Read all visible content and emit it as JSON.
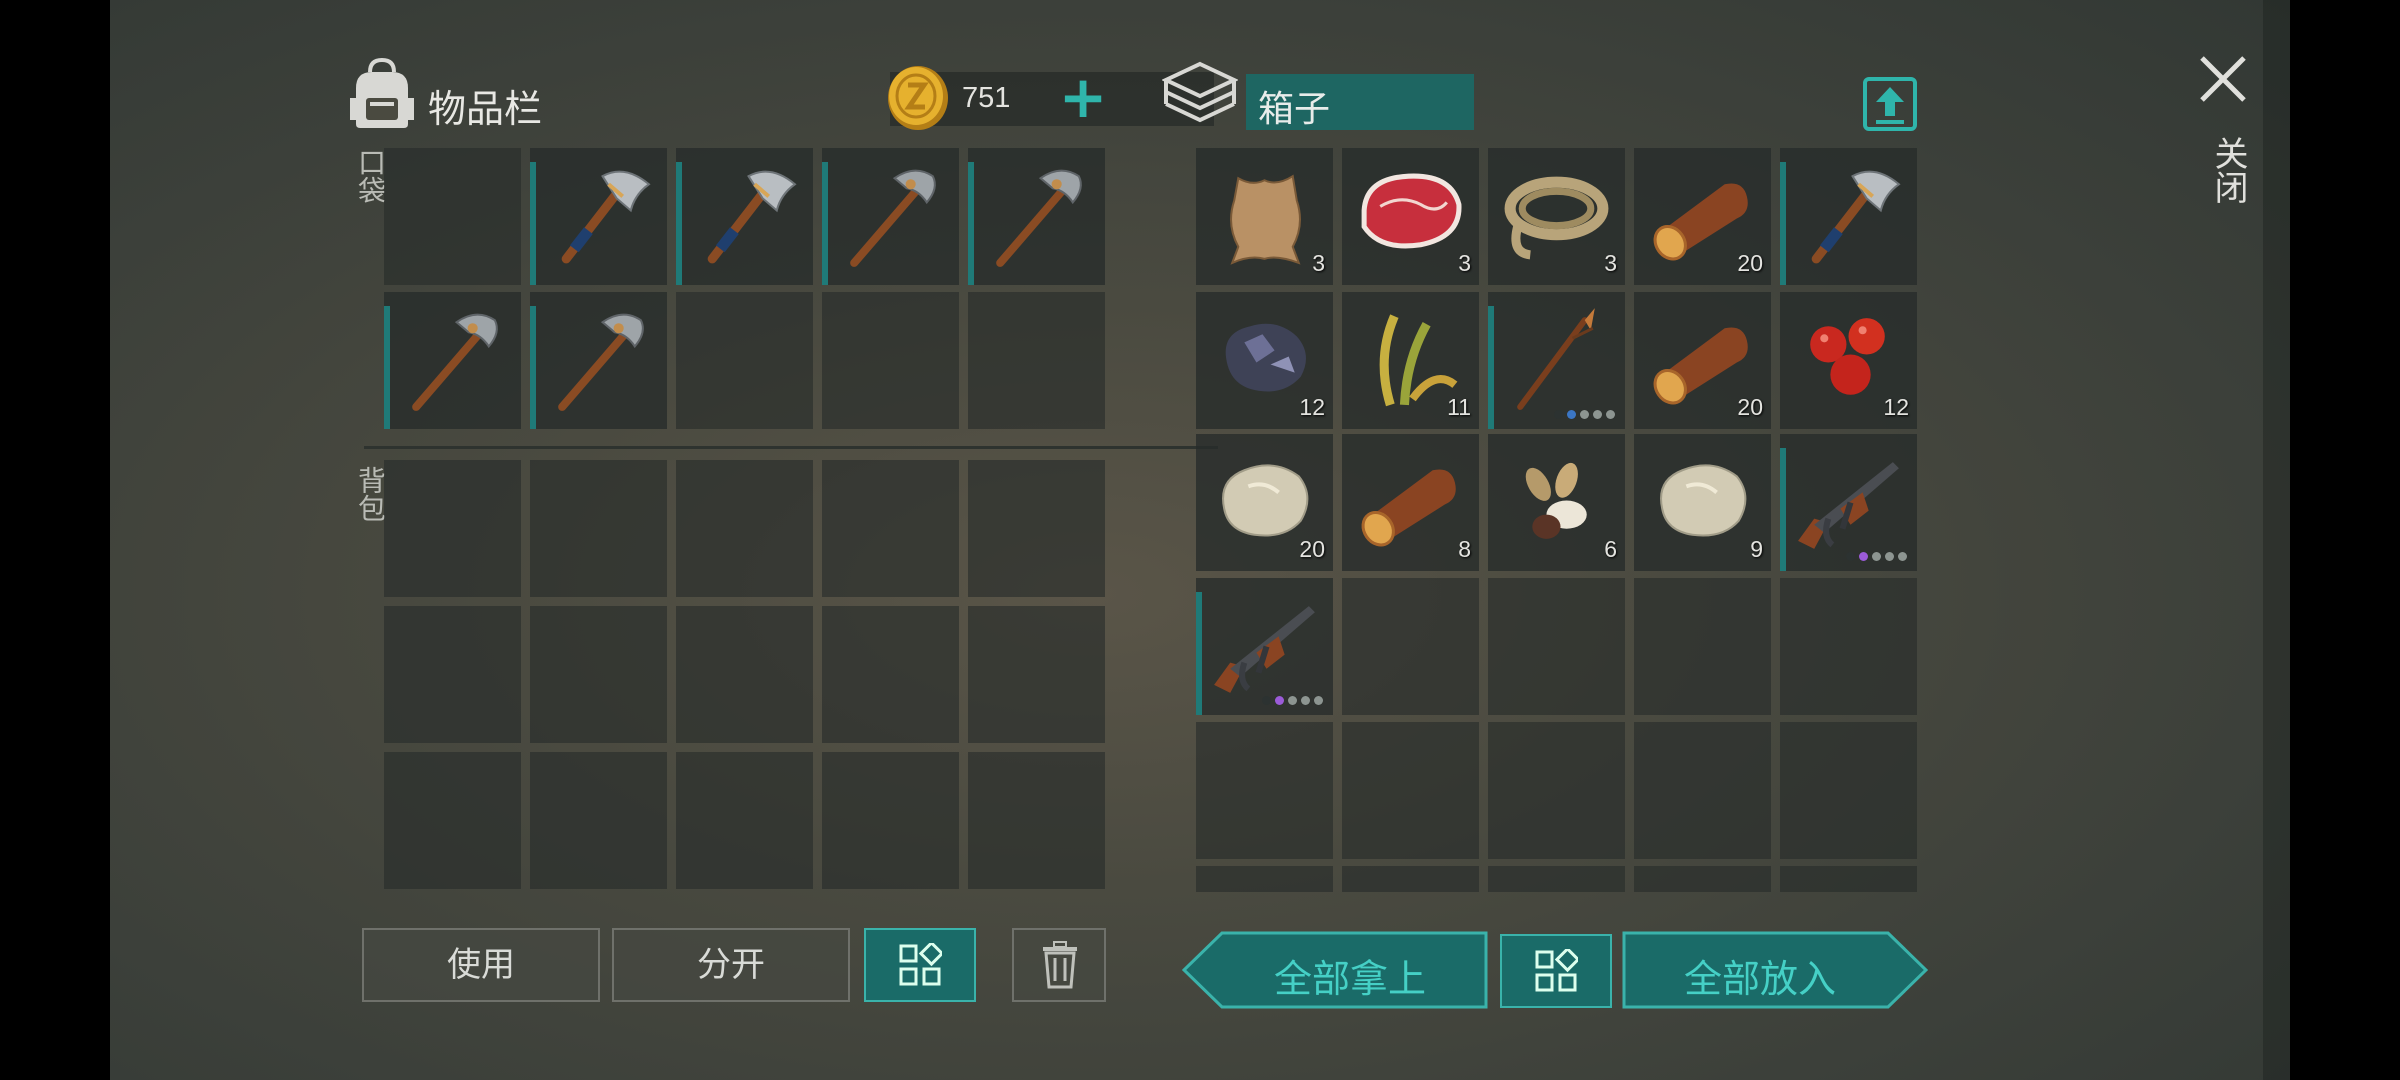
{
  "inventory": {
    "title": "物品栏",
    "coins": "751",
    "add_symbol": "+",
    "pocket_label": "口袋",
    "backpack_label": "背包",
    "use_label": "使用",
    "split_label": "分开"
  },
  "box": {
    "title": "箱子",
    "take_all_label": "全部拿上",
    "put_all_label": "全部放入"
  },
  "close_label": "关闭",
  "pocket_slots": [
    {
      "item": "empty"
    },
    {
      "item": "axe-icon"
    },
    {
      "item": "axe-icon"
    },
    {
      "item": "pickaxe-icon"
    },
    {
      "item": "pickaxe-icon"
    },
    {
      "item": "pickaxe-icon"
    },
    {
      "item": "pickaxe-icon"
    },
    {
      "item": "empty"
    },
    {
      "item": "empty"
    },
    {
      "item": "empty"
    }
  ],
  "box_slots": [
    {
      "item": "leather-icon",
      "qty": "3"
    },
    {
      "item": "meat-icon",
      "qty": "3"
    },
    {
      "item": "rope-icon",
      "qty": "3"
    },
    {
      "item": "log-icon",
      "qty": "20"
    },
    {
      "item": "axe-icon"
    },
    {
      "item": "ore-icon",
      "qty": "12"
    },
    {
      "item": "plant-fiber-icon",
      "qty": "11"
    },
    {
      "item": "spear-icon",
      "rarity": "blue"
    },
    {
      "item": "log-icon",
      "qty": "20"
    },
    {
      "item": "berries-icon",
      "qty": "12"
    },
    {
      "item": "stone-icon",
      "qty": "20"
    },
    {
      "item": "log-icon",
      "qty": "8"
    },
    {
      "item": "seeds-icon",
      "qty": "6"
    },
    {
      "item": "stone-icon",
      "qty": "9"
    },
    {
      "item": "rifle-icon",
      "rarity": "purple"
    },
    {
      "item": "rifle-icon",
      "rarity": "purple"
    }
  ],
  "colors": {
    "accent": "#1a6b68",
    "accent_light": "#3ab3ab",
    "coin": "#d8a324"
  }
}
